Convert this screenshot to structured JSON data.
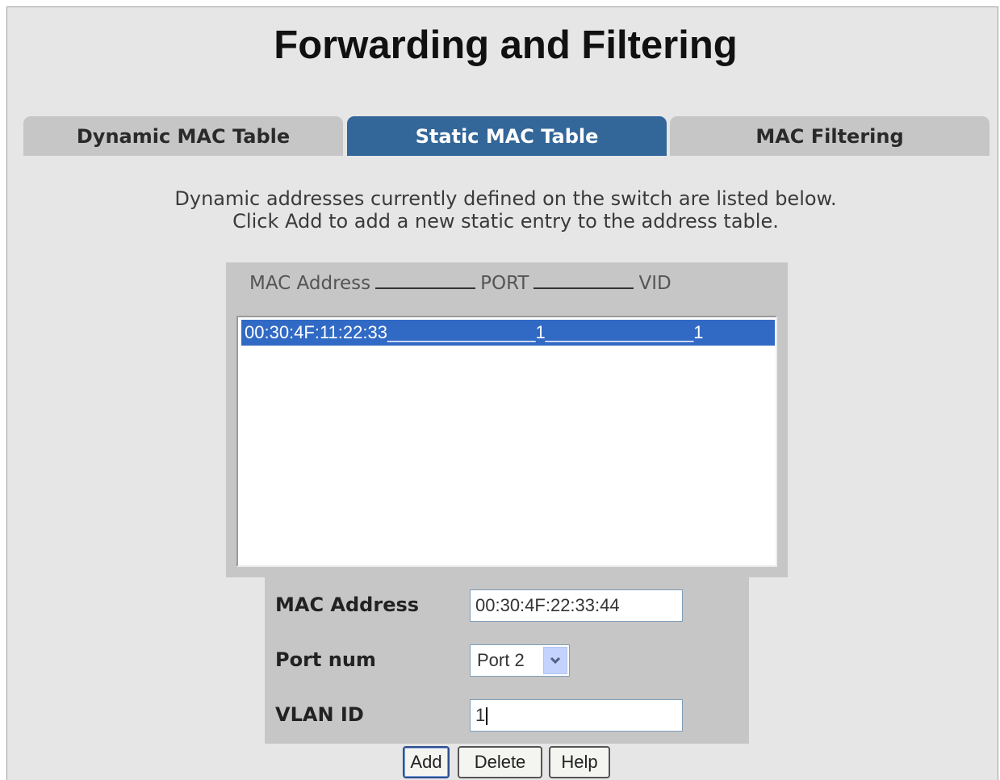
{
  "page": {
    "title": "Forwarding and Filtering",
    "description_line1": "Dynamic addresses currently defined on the switch are listed below.",
    "description_line2": "Click Add to add a new static entry to the address table."
  },
  "tabs": [
    {
      "label": "Dynamic MAC Table",
      "active": false
    },
    {
      "label": "Static MAC Table",
      "active": true
    },
    {
      "label": "MAC Filtering",
      "active": false
    }
  ],
  "table": {
    "header": {
      "col1": "MAC Address",
      "col2": "PORT",
      "col3": "VID"
    },
    "rows": [
      {
        "text": "00:30:4F:11:22:33_______________1_______________1",
        "selected": true
      }
    ]
  },
  "form": {
    "mac_label": "MAC Address",
    "mac_value": "00:30:4F:22:33:44",
    "port_label": "Port num",
    "port_value": "Port 2",
    "vlan_label": "VLAN ID",
    "vlan_value": "1"
  },
  "buttons": {
    "add": "Add",
    "delete": "Delete",
    "help": "Help"
  },
  "colors": {
    "active_tab": "#336699",
    "selected_row": "#316ac5",
    "panel_bg": "#e6e6e6",
    "box_bg": "#c6c6c6"
  },
  "icons": {
    "select_arrow": "chevron-down-icon"
  }
}
